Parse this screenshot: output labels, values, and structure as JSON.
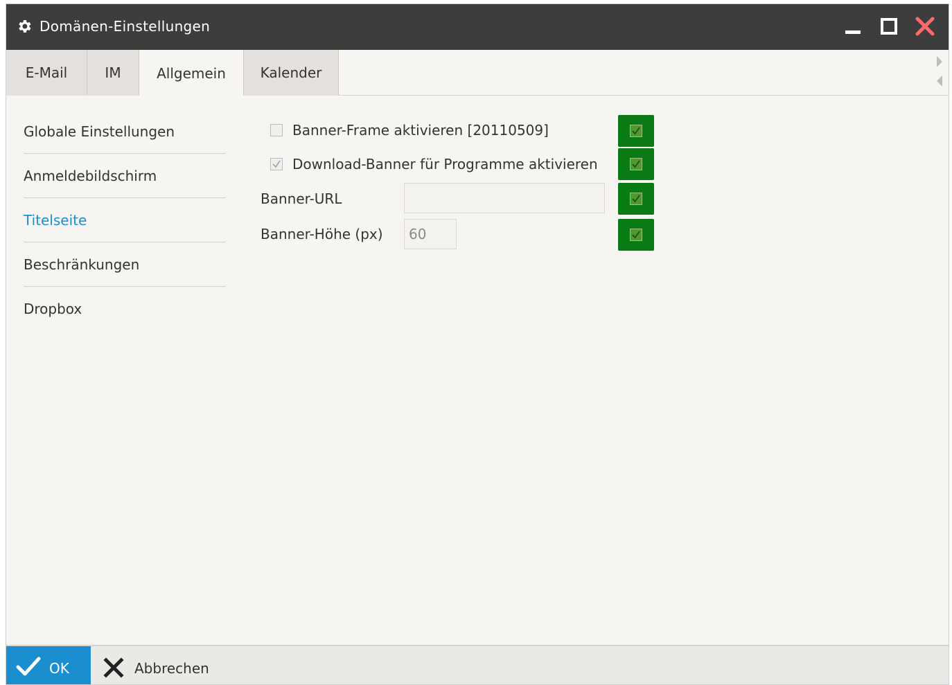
{
  "window": {
    "title": "Domänen-Einstellungen",
    "icon": "gear-icon",
    "controls": [
      "minimize-icon",
      "maximize-icon",
      "close-icon"
    ],
    "close_color": "#ff6b6b"
  },
  "tabs": [
    {
      "label": "E-Mail",
      "active": false
    },
    {
      "label": "IM",
      "active": false
    },
    {
      "label": "Allgemein",
      "active": true
    },
    {
      "label": "Kalender",
      "active": false
    }
  ],
  "sidebar": {
    "items": [
      {
        "label": "Globale Einstellungen",
        "active": false
      },
      {
        "label": "Anmeldebildschirm",
        "active": false
      },
      {
        "label": "Titelseite",
        "active": true
      },
      {
        "label": "Beschränkungen",
        "active": false
      },
      {
        "label": "Dropbox",
        "active": false
      }
    ],
    "active_color": "#1b8ed0"
  },
  "form": {
    "banner_frame": {
      "label": "Banner-Frame aktivieren [20110509]",
      "checked": false
    },
    "download_banner": {
      "label": "Download-Banner für Programme aktivieren",
      "checked": true
    },
    "banner_url": {
      "label": "Banner-URL",
      "value": ""
    },
    "banner_height": {
      "label": "Banner-Höhe (px)",
      "value": "60"
    },
    "override_color": "#0a7a14"
  },
  "footer": {
    "ok_label": "OK",
    "cancel_label": "Abbrechen",
    "ok_color": "#1b8ed0"
  }
}
